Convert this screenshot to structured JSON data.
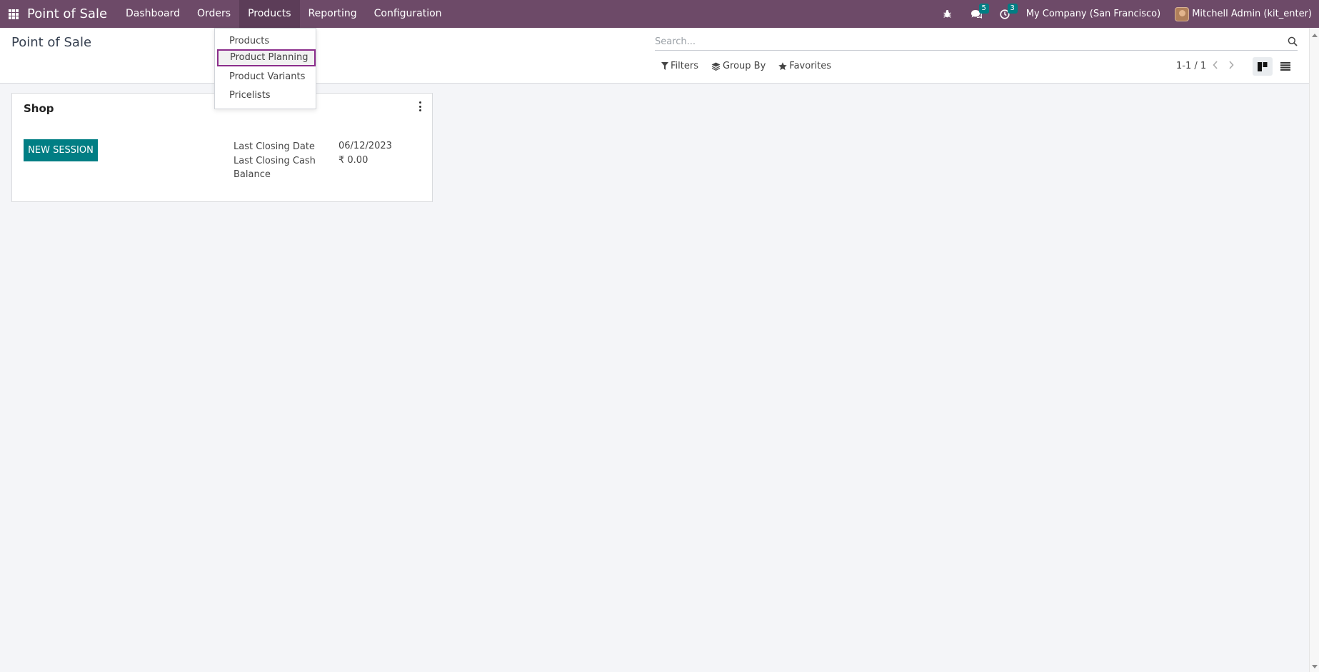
{
  "navbar": {
    "app_name": "Point of Sale",
    "menu": [
      "Dashboard",
      "Orders",
      "Products",
      "Reporting",
      "Configuration"
    ],
    "active_menu": "Products",
    "messages_count": "5",
    "activities_count": "3",
    "company": "My Company (San Francisco)",
    "user": "Mitchell Admin (kit_enter)",
    "bar_color": "#6d4a68"
  },
  "products_dropdown": {
    "items": [
      "Products",
      "Product Planning",
      "Product Variants",
      "Pricelists"
    ],
    "highlighted": "Product Planning"
  },
  "control_panel": {
    "title": "Point of Sale",
    "search_placeholder": "Search...",
    "filters_label": "Filters",
    "group_by_label": "Group By",
    "favorites_label": "Favorites",
    "pager": "1-1 / 1",
    "active_view": "kanban"
  },
  "card": {
    "title": "Shop",
    "button_label": "NEW SESSION",
    "button_color": "#017e84",
    "closing_date_label": "Last Closing Date",
    "closing_date_value": "06/12/2023",
    "closing_cash_label_line1": "Last Closing Cash",
    "closing_cash_label_line2": "Balance",
    "closing_cash_value": "₹ 0.00"
  }
}
